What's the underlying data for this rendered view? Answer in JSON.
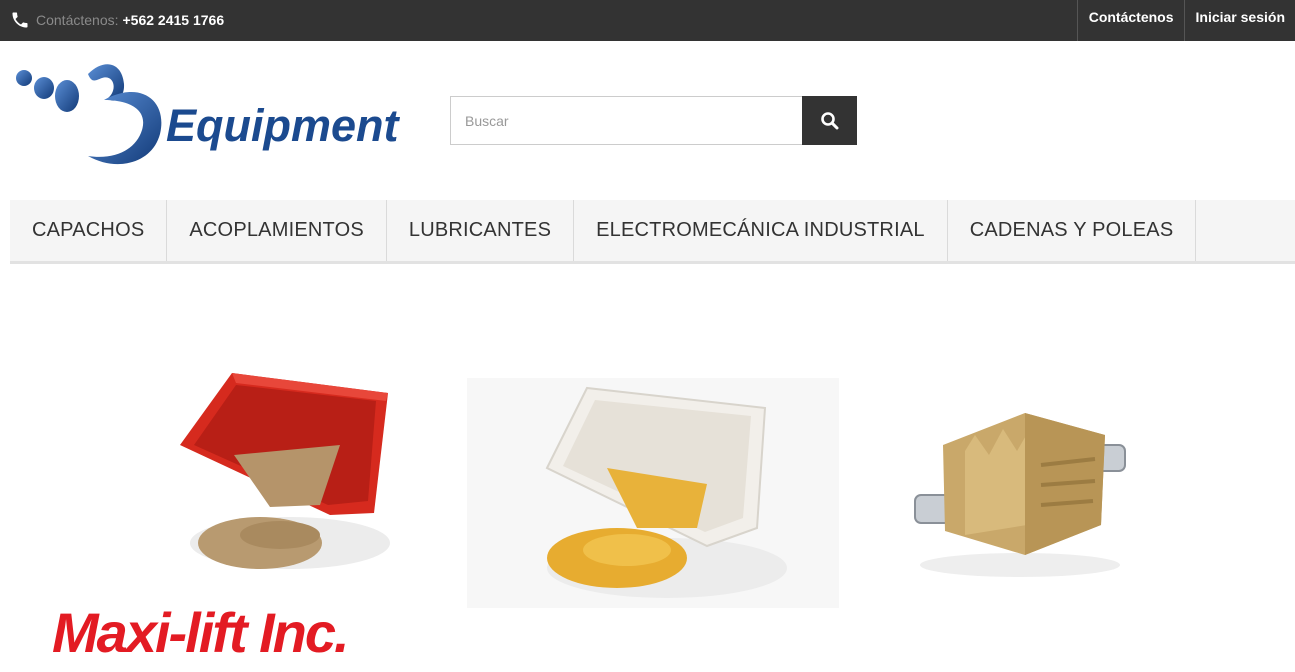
{
  "topbar": {
    "icon": "phone-icon",
    "contact_label": "Contáctenos:",
    "contact_number": "+562 2415 1766",
    "links": [
      "Contáctenos",
      "Iniciar sesión"
    ]
  },
  "header": {
    "logo_text": "Equipment",
    "search": {
      "placeholder": "Buscar",
      "value": "",
      "icon": "search-icon"
    }
  },
  "nav": {
    "items": [
      "CAPACHOS",
      "ACOPLAMIENTOS",
      "LUBRICANTES",
      "ELECTROMECÁNICA INDUSTRIAL",
      "CADENAS Y POLEAS"
    ]
  },
  "products": [
    {
      "name": "red-bucket-image"
    },
    {
      "name": "white-bucket-image"
    },
    {
      "name": "brass-coupling-image"
    }
  ],
  "brand": {
    "text": "Maxi-lift Inc."
  },
  "colors": {
    "topbar": "#333333",
    "logo_blue": "#1b4a8f",
    "brand_red": "#e31b23",
    "nav_bg": "#f5f5f5"
  }
}
